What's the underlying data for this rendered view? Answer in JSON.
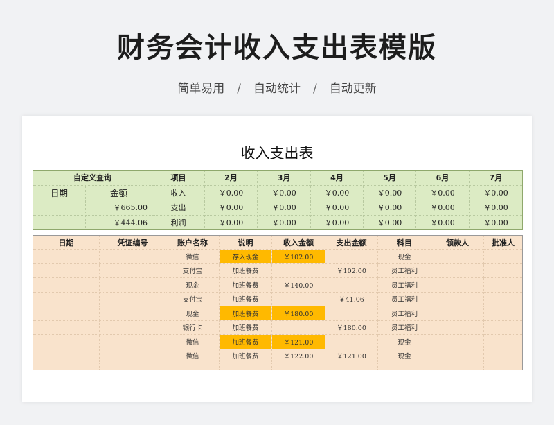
{
  "title": "财务会计收入支出表模版",
  "tags": [
    "简单易用",
    "自动统计",
    "自动更新"
  ],
  "tag_separator": "/",
  "sheet_title": "收入支出表",
  "summary": {
    "header": [
      "自定义查询",
      "项目",
      "2月",
      "3月",
      "4月",
      "5月",
      "6月",
      "7月"
    ],
    "query_labels": [
      "日期",
      "金额"
    ],
    "rows": [
      {
        "query": "",
        "item": "收入",
        "values": [
          "￥0.00",
          "￥0.00",
          "￥0.00",
          "￥0.00",
          "￥0.00",
          "￥0.00"
        ]
      },
      {
        "query": "￥665.00",
        "item": "支出",
        "values": [
          "￥0.00",
          "￥0.00",
          "￥0.00",
          "￥0.00",
          "￥0.00",
          "￥0.00"
        ]
      },
      {
        "query": "￥444.06",
        "item": "利润",
        "values": [
          "￥0.00",
          "￥0.00",
          "￥0.00",
          "￥0.00",
          "￥0.00",
          "￥0.00"
        ]
      }
    ]
  },
  "ledger": {
    "columns": [
      "日期",
      "凭证编号",
      "账户名称",
      "说明",
      "收入金额",
      "支出金额",
      "科目",
      "领款人",
      "批准人"
    ],
    "rows": [
      [
        "",
        "",
        "微信",
        "存入现金",
        "￥102.00",
        "",
        "现金",
        "",
        ""
      ],
      [
        "",
        "",
        "支付宝",
        "加班餐费",
        "",
        "￥102.00",
        "员工福利",
        "",
        ""
      ],
      [
        "",
        "",
        "现金",
        "加班餐费",
        "￥140.00",
        "",
        "员工福利",
        "",
        ""
      ],
      [
        "",
        "",
        "支付宝",
        "加班餐费",
        "",
        "￥41.06",
        "员工福利",
        "",
        ""
      ],
      [
        "",
        "",
        "现金",
        "加班餐费",
        "￥180.00",
        "",
        "员工福利",
        "",
        ""
      ],
      [
        "",
        "",
        "银行卡",
        "加班餐费",
        "",
        "￥180.00",
        "员工福利",
        "",
        ""
      ],
      [
        "",
        "",
        "微信",
        "加班餐费",
        "￥121.00",
        "",
        "现金",
        "",
        ""
      ],
      [
        "",
        "",
        "微信",
        "加班餐费",
        "￥122.00",
        "￥121.00",
        "现金",
        "",
        ""
      ]
    ],
    "highlighted_rows": [
      0,
      4,
      6
    ],
    "highlight_color": "#ffb900"
  },
  "colors": {
    "summary_bg": "#dcebc4",
    "ledger_bg": "#f9e3cc",
    "highlight": "#ffb900"
  }
}
